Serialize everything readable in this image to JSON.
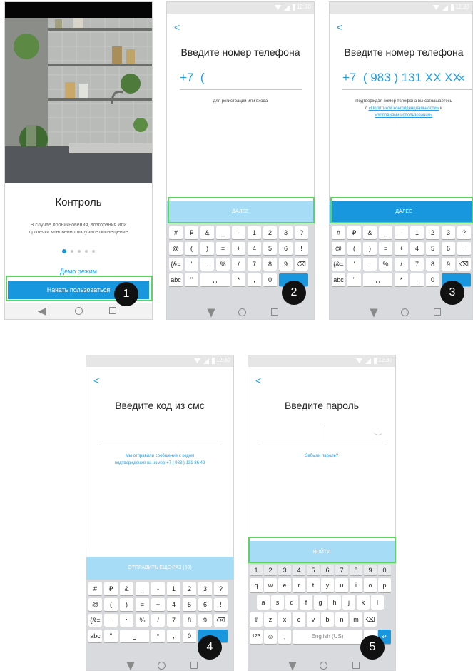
{
  "screen1": {
    "title": "Контроль",
    "desc_line1": "В случае проникновения, возгорания или",
    "desc_line2": "протечки мгновенно получите оповещение",
    "demo_link": "Демо режим",
    "start_button": "Начать пользоваться",
    "step": "1"
  },
  "screen2": {
    "status_time": "12:30",
    "title": "Введите номер телефона",
    "phone_value": "+7  (",
    "hint": "для регистрации или входа",
    "next_button": "ДАЛЕЕ",
    "step": "2"
  },
  "screen3": {
    "status_time": "12:30",
    "title": "Введите номер телефона",
    "phone_value": "+7  ( 983 ) 131 XX XX",
    "clear": "×",
    "consent_line1": "Подтверждая номер телефона вы соглашаетесь",
    "consent_prefix": "с",
    "policy_link": "«Политикой конфиденциальности»",
    "consent_and": "и",
    "terms_link": "«Условиями использования»",
    "next_button": "ДАЛЕЕ",
    "step": "3"
  },
  "screen4": {
    "status_time": "12:30",
    "title": "Введите код из смс",
    "sms_line1": "Мы отправили сообщение с кодом",
    "sms_line2": "подтверждения на номер +7 ( 983 ) 131 86 42",
    "resend_button": "ОТПРАВИТЬ ЕЩЕ РАЗ (60)",
    "step": "4"
  },
  "screen5": {
    "status_time": "12:30",
    "title": "Введите пароль",
    "forgot_link": "Забыли пароль?",
    "login_button": "ВОЙТИ",
    "space_label": "English (US)",
    "step": "5"
  },
  "numeric_keyboard": {
    "row1": [
      "#",
      "₽",
      "&",
      "_",
      "-",
      "1",
      "2",
      "3",
      "?"
    ],
    "row2": [
      "@",
      "(",
      ")",
      "=",
      "+",
      "4",
      "5",
      "6",
      "!"
    ],
    "row3": [
      "{&=",
      "'",
      ":",
      "%",
      "/",
      "7",
      "8",
      "9",
      "⌫"
    ],
    "row4": [
      "abc",
      "\"",
      "␣",
      "*",
      ",",
      "0",
      "."
    ]
  },
  "qwerty_keyboard": {
    "numbers": [
      "1",
      "2",
      "3",
      "4",
      "5",
      "6",
      "7",
      "8",
      "9",
      "0"
    ],
    "row1": [
      "q",
      "w",
      "e",
      "r",
      "t",
      "y",
      "u",
      "i",
      "o",
      "p"
    ],
    "row2": [
      "a",
      "s",
      "d",
      "f",
      "g",
      "h",
      "j",
      "k",
      "l"
    ],
    "row3": [
      "⇧",
      "z",
      "x",
      "c",
      "v",
      "b",
      "n",
      "m",
      "⌫"
    ],
    "row4_left": "123",
    "emoji": "☺"
  },
  "colors": {
    "accent": "#1997de",
    "accent_light": "#a7dcf6",
    "highlight": "#5fd35f"
  }
}
